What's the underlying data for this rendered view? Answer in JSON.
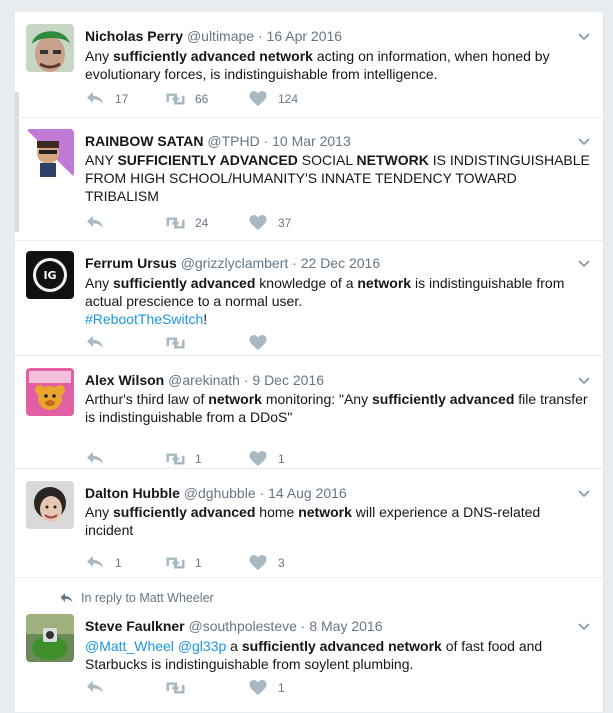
{
  "colors": {
    "icon": "#aab8c2",
    "link": "#1b95e0",
    "muted": "#657786",
    "text": "#14171a"
  },
  "tweets": [
    {
      "name": "Nicholas Perry",
      "handle": "@ultimape",
      "date": "16 Apr 2016",
      "text_parts": [
        {
          "t": "Any "
        },
        {
          "t": "sufficiently advanced network",
          "b": true
        },
        {
          "t": " acting on information, when honed by evolutionary forces, is indistinguishable from intelligence."
        }
      ],
      "replies": "17",
      "retweets": "66",
      "likes": "124"
    },
    {
      "name": "RAINBOW SATAN",
      "handle": "@TPHD",
      "date": "10 Mar 2013",
      "text_parts": [
        {
          "t": "ANY "
        },
        {
          "t": "SUFFICIENTLY ADVANCED",
          "b": true
        },
        {
          "t": " SOCIAL "
        },
        {
          "t": "NETWORK",
          "b": true
        },
        {
          "t": " IS INDISTINGUISHABLE FROM HIGH SCHOOL/HUMANITY'S INNATE TENDENCY TOWARD TRIBALISM"
        }
      ],
      "replies": "",
      "retweets": "24",
      "likes": "37"
    },
    {
      "name": "Ferrum Ursus",
      "handle": "@grizzlyclambert",
      "date": "22 Dec 2016",
      "text_parts": [
        {
          "t": "Any "
        },
        {
          "t": "sufficiently advanced",
          "b": true
        },
        {
          "t": " knowledge of a "
        },
        {
          "t": "network",
          "b": true
        },
        {
          "t": " is indistinguishable from actual prescience to a normal user."
        },
        {
          "br": true
        },
        {
          "t": "#RebootTheSwitch",
          "link": true
        },
        {
          "t": "!"
        }
      ],
      "replies": "",
      "retweets": "",
      "likes": ""
    },
    {
      "name": "Alex Wilson",
      "handle": "@arekinath",
      "date": "9 Dec 2016",
      "text_parts": [
        {
          "t": "Arthur's third law of "
        },
        {
          "t": "network",
          "b": true
        },
        {
          "t": " monitoring: \"Any "
        },
        {
          "t": "sufficiently advanced",
          "b": true
        },
        {
          "t": " file transfer is indistinguishable from a DDoS\""
        }
      ],
      "replies": "",
      "retweets": "1",
      "likes": "1"
    },
    {
      "name": "Dalton Hubble",
      "handle": "@dghubble",
      "date": "14 Aug 2016",
      "text_parts": [
        {
          "t": "Any "
        },
        {
          "t": "sufficiently advanced",
          "b": true
        },
        {
          "t": " home "
        },
        {
          "t": "network",
          "b": true
        },
        {
          "t": " will experience a DNS-related incident"
        }
      ],
      "replies": "1",
      "retweets": "1",
      "likes": "3"
    },
    {
      "reply_context": "In reply to Matt Wheeler",
      "name": "Steve Faulkner",
      "handle": "@southpolesteve",
      "date": "8 May 2016",
      "text_parts": [
        {
          "t": "@Matt_Wheel",
          "link": true
        },
        {
          "t": " "
        },
        {
          "t": "@gl33p",
          "link": true
        },
        {
          "t": " a "
        },
        {
          "t": "sufficiently advanced network",
          "b": true
        },
        {
          "t": " of fast food and Starbucks is indistinguishable from soylent plumbing."
        }
      ],
      "replies": "",
      "retweets": "",
      "likes": "1"
    }
  ]
}
